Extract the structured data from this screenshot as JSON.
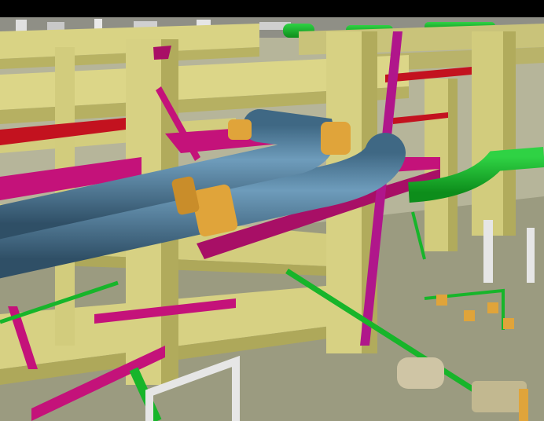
{
  "scene": {
    "kind": "3D plant model render",
    "subject": "pipe rack",
    "top_bar": "black",
    "colors": {
      "structure": "#d2cc7d",
      "structure_dark": "#b1ab5c",
      "main_pipe": "#4b7896",
      "main_pipe_highlight": "#6e9cbb",
      "pipe_clamp": "#e0a43a",
      "magenta_steel": "#c4127a",
      "green_pipe": "#17b52a",
      "red_pipe": "#c3121f",
      "floor": "#9b9b80",
      "white_pipe": "#e6e6e6"
    }
  }
}
